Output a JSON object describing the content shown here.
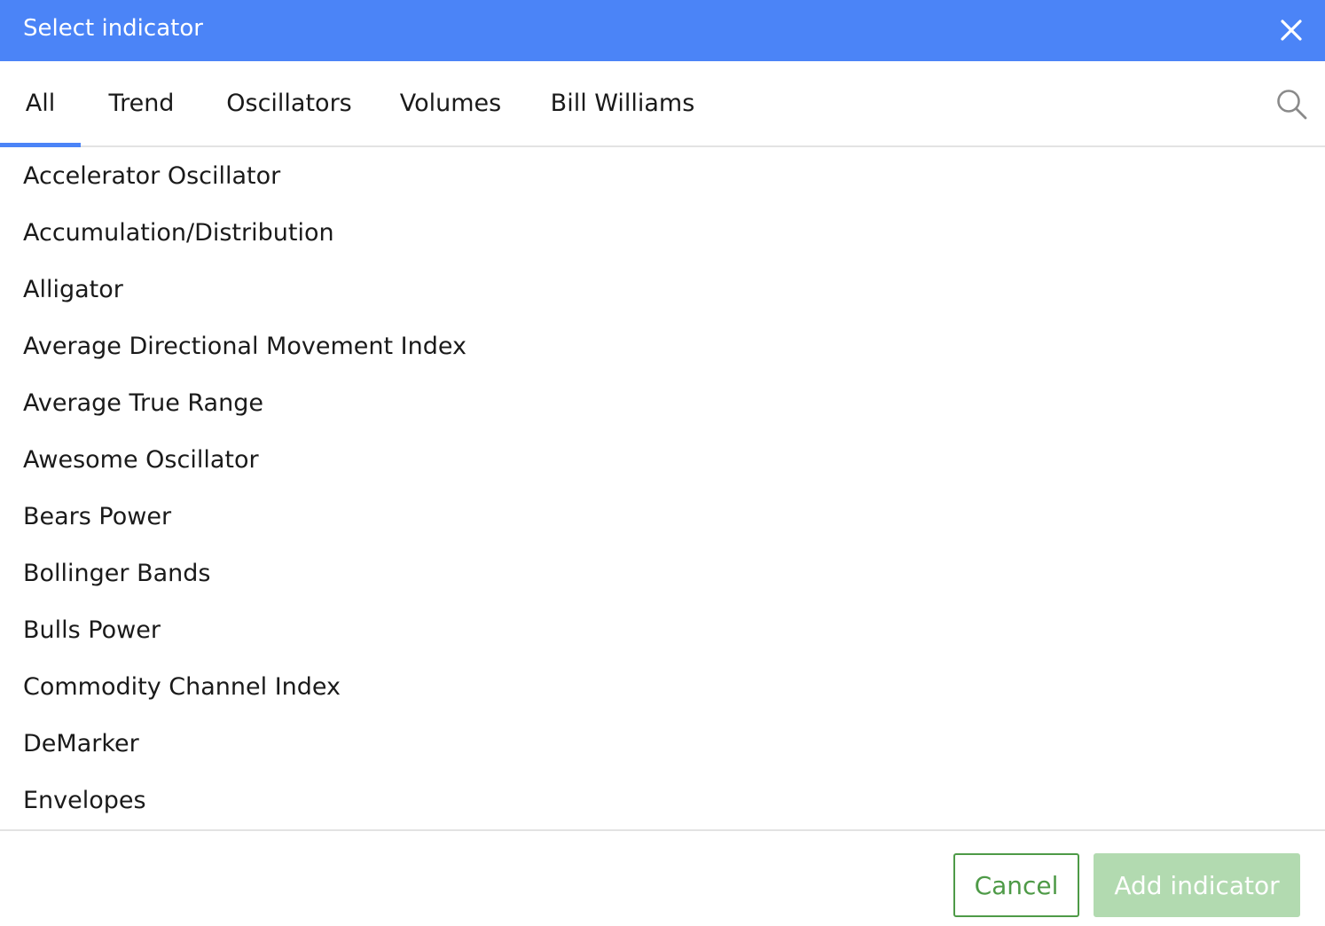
{
  "dialog": {
    "title": "Select indicator",
    "colors": {
      "header": "#4b84f7",
      "accent": "#4b84f7",
      "cancel": "#4e9a47",
      "add_disabled": "#b2dab0"
    }
  },
  "tabs": [
    {
      "label": "All",
      "active": true
    },
    {
      "label": "Trend",
      "active": false
    },
    {
      "label": "Oscillators",
      "active": false
    },
    {
      "label": "Volumes",
      "active": false
    },
    {
      "label": "Bill Williams",
      "active": false
    }
  ],
  "indicators": [
    "Accelerator Oscillator",
    "Accumulation/Distribution",
    "Alligator",
    "Average Directional Movement Index",
    "Average True Range",
    "Awesome Oscillator",
    "Bears Power",
    "Bollinger Bands",
    "Bulls Power",
    "Commodity Channel Index",
    "DeMarker",
    "Envelopes"
  ],
  "footer": {
    "cancel_label": "Cancel",
    "add_label": "Add indicator"
  },
  "icons": {
    "close": "close-icon",
    "search": "search-icon"
  }
}
